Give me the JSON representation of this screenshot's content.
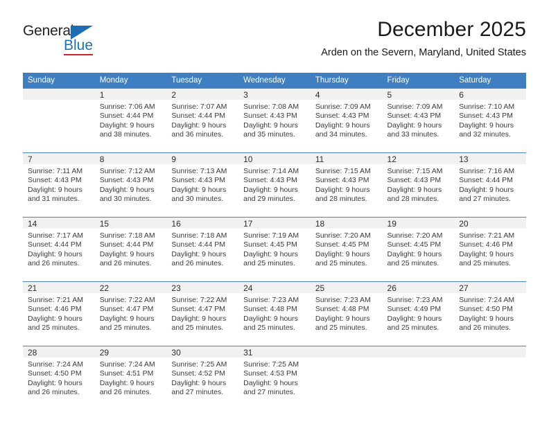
{
  "brand": {
    "name_part1": "General",
    "name_part2": "Blue",
    "triangle_color": "#1b6cb3",
    "blue_color": "#1b72bb",
    "underline_color": "#cf2128",
    "text_color": "#231f20"
  },
  "header": {
    "title": "December 2025",
    "subtitle": "Arden on the Severn, Maryland, United States"
  },
  "colors": {
    "header_bg": "#3f7fc1",
    "header_text": "#ffffff",
    "row_separator": "#4a86c5",
    "daynum_band_alt": "#f1f1f1",
    "body_text": "#3a3a3a"
  },
  "calendar": {
    "weekday_headers": [
      "Sunday",
      "Monday",
      "Tuesday",
      "Wednesday",
      "Thursday",
      "Friday",
      "Saturday"
    ],
    "weeks": [
      [
        {
          "day": "",
          "sunrise": "",
          "sunset": "",
          "daylight_line1": "",
          "daylight_line2": ""
        },
        {
          "day": "1",
          "sunrise": "Sunrise: 7:06 AM",
          "sunset": "Sunset: 4:44 PM",
          "daylight_line1": "Daylight: 9 hours",
          "daylight_line2": "and 38 minutes."
        },
        {
          "day": "2",
          "sunrise": "Sunrise: 7:07 AM",
          "sunset": "Sunset: 4:44 PM",
          "daylight_line1": "Daylight: 9 hours",
          "daylight_line2": "and 36 minutes."
        },
        {
          "day": "3",
          "sunrise": "Sunrise: 7:08 AM",
          "sunset": "Sunset: 4:43 PM",
          "daylight_line1": "Daylight: 9 hours",
          "daylight_line2": "and 35 minutes."
        },
        {
          "day": "4",
          "sunrise": "Sunrise: 7:09 AM",
          "sunset": "Sunset: 4:43 PM",
          "daylight_line1": "Daylight: 9 hours",
          "daylight_line2": "and 34 minutes."
        },
        {
          "day": "5",
          "sunrise": "Sunrise: 7:09 AM",
          "sunset": "Sunset: 4:43 PM",
          "daylight_line1": "Daylight: 9 hours",
          "daylight_line2": "and 33 minutes."
        },
        {
          "day": "6",
          "sunrise": "Sunrise: 7:10 AM",
          "sunset": "Sunset: 4:43 PM",
          "daylight_line1": "Daylight: 9 hours",
          "daylight_line2": "and 32 minutes."
        }
      ],
      [
        {
          "day": "7",
          "sunrise": "Sunrise: 7:11 AM",
          "sunset": "Sunset: 4:43 PM",
          "daylight_line1": "Daylight: 9 hours",
          "daylight_line2": "and 31 minutes."
        },
        {
          "day": "8",
          "sunrise": "Sunrise: 7:12 AM",
          "sunset": "Sunset: 4:43 PM",
          "daylight_line1": "Daylight: 9 hours",
          "daylight_line2": "and 30 minutes."
        },
        {
          "day": "9",
          "sunrise": "Sunrise: 7:13 AM",
          "sunset": "Sunset: 4:43 PM",
          "daylight_line1": "Daylight: 9 hours",
          "daylight_line2": "and 30 minutes."
        },
        {
          "day": "10",
          "sunrise": "Sunrise: 7:14 AM",
          "sunset": "Sunset: 4:43 PM",
          "daylight_line1": "Daylight: 9 hours",
          "daylight_line2": "and 29 minutes."
        },
        {
          "day": "11",
          "sunrise": "Sunrise: 7:15 AM",
          "sunset": "Sunset: 4:43 PM",
          "daylight_line1": "Daylight: 9 hours",
          "daylight_line2": "and 28 minutes."
        },
        {
          "day": "12",
          "sunrise": "Sunrise: 7:15 AM",
          "sunset": "Sunset: 4:43 PM",
          "daylight_line1": "Daylight: 9 hours",
          "daylight_line2": "and 28 minutes."
        },
        {
          "day": "13",
          "sunrise": "Sunrise: 7:16 AM",
          "sunset": "Sunset: 4:44 PM",
          "daylight_line1": "Daylight: 9 hours",
          "daylight_line2": "and 27 minutes."
        }
      ],
      [
        {
          "day": "14",
          "sunrise": "Sunrise: 7:17 AM",
          "sunset": "Sunset: 4:44 PM",
          "daylight_line1": "Daylight: 9 hours",
          "daylight_line2": "and 26 minutes."
        },
        {
          "day": "15",
          "sunrise": "Sunrise: 7:18 AM",
          "sunset": "Sunset: 4:44 PM",
          "daylight_line1": "Daylight: 9 hours",
          "daylight_line2": "and 26 minutes."
        },
        {
          "day": "16",
          "sunrise": "Sunrise: 7:18 AM",
          "sunset": "Sunset: 4:44 PM",
          "daylight_line1": "Daylight: 9 hours",
          "daylight_line2": "and 26 minutes."
        },
        {
          "day": "17",
          "sunrise": "Sunrise: 7:19 AM",
          "sunset": "Sunset: 4:45 PM",
          "daylight_line1": "Daylight: 9 hours",
          "daylight_line2": "and 25 minutes."
        },
        {
          "day": "18",
          "sunrise": "Sunrise: 7:20 AM",
          "sunset": "Sunset: 4:45 PM",
          "daylight_line1": "Daylight: 9 hours",
          "daylight_line2": "and 25 minutes."
        },
        {
          "day": "19",
          "sunrise": "Sunrise: 7:20 AM",
          "sunset": "Sunset: 4:45 PM",
          "daylight_line1": "Daylight: 9 hours",
          "daylight_line2": "and 25 minutes."
        },
        {
          "day": "20",
          "sunrise": "Sunrise: 7:21 AM",
          "sunset": "Sunset: 4:46 PM",
          "daylight_line1": "Daylight: 9 hours",
          "daylight_line2": "and 25 minutes."
        }
      ],
      [
        {
          "day": "21",
          "sunrise": "Sunrise: 7:21 AM",
          "sunset": "Sunset: 4:46 PM",
          "daylight_line1": "Daylight: 9 hours",
          "daylight_line2": "and 25 minutes."
        },
        {
          "day": "22",
          "sunrise": "Sunrise: 7:22 AM",
          "sunset": "Sunset: 4:47 PM",
          "daylight_line1": "Daylight: 9 hours",
          "daylight_line2": "and 25 minutes."
        },
        {
          "day": "23",
          "sunrise": "Sunrise: 7:22 AM",
          "sunset": "Sunset: 4:47 PM",
          "daylight_line1": "Daylight: 9 hours",
          "daylight_line2": "and 25 minutes."
        },
        {
          "day": "24",
          "sunrise": "Sunrise: 7:23 AM",
          "sunset": "Sunset: 4:48 PM",
          "daylight_line1": "Daylight: 9 hours",
          "daylight_line2": "and 25 minutes."
        },
        {
          "day": "25",
          "sunrise": "Sunrise: 7:23 AM",
          "sunset": "Sunset: 4:48 PM",
          "daylight_line1": "Daylight: 9 hours",
          "daylight_line2": "and 25 minutes."
        },
        {
          "day": "26",
          "sunrise": "Sunrise: 7:23 AM",
          "sunset": "Sunset: 4:49 PM",
          "daylight_line1": "Daylight: 9 hours",
          "daylight_line2": "and 25 minutes."
        },
        {
          "day": "27",
          "sunrise": "Sunrise: 7:24 AM",
          "sunset": "Sunset: 4:50 PM",
          "daylight_line1": "Daylight: 9 hours",
          "daylight_line2": "and 26 minutes."
        }
      ],
      [
        {
          "day": "28",
          "sunrise": "Sunrise: 7:24 AM",
          "sunset": "Sunset: 4:50 PM",
          "daylight_line1": "Daylight: 9 hours",
          "daylight_line2": "and 26 minutes."
        },
        {
          "day": "29",
          "sunrise": "Sunrise: 7:24 AM",
          "sunset": "Sunset: 4:51 PM",
          "daylight_line1": "Daylight: 9 hours",
          "daylight_line2": "and 26 minutes."
        },
        {
          "day": "30",
          "sunrise": "Sunrise: 7:25 AM",
          "sunset": "Sunset: 4:52 PM",
          "daylight_line1": "Daylight: 9 hours",
          "daylight_line2": "and 27 minutes."
        },
        {
          "day": "31",
          "sunrise": "Sunrise: 7:25 AM",
          "sunset": "Sunset: 4:53 PM",
          "daylight_line1": "Daylight: 9 hours",
          "daylight_line2": "and 27 minutes."
        },
        {
          "day": "",
          "sunrise": "",
          "sunset": "",
          "daylight_line1": "",
          "daylight_line2": ""
        },
        {
          "day": "",
          "sunrise": "",
          "sunset": "",
          "daylight_line1": "",
          "daylight_line2": ""
        },
        {
          "day": "",
          "sunrise": "",
          "sunset": "",
          "daylight_line1": "",
          "daylight_line2": ""
        }
      ]
    ]
  }
}
